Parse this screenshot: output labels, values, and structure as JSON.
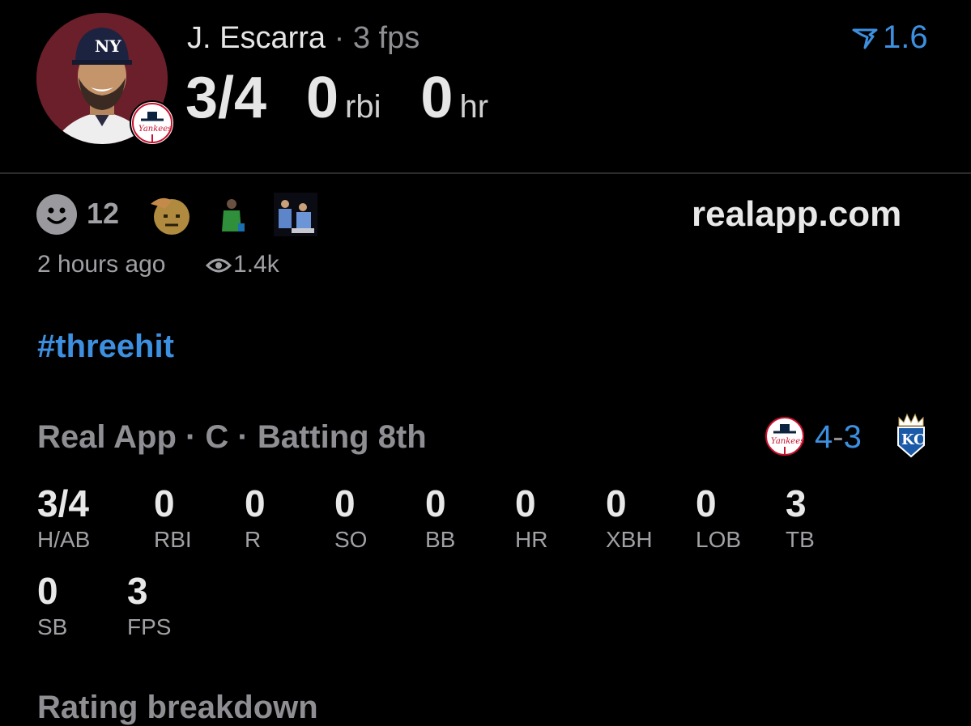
{
  "header": {
    "player_name": "J. Escarra",
    "separator": "·",
    "fps_text": "3 fps",
    "hits_ab": "3/4",
    "rbi_value": "0",
    "rbi_unit": "rbi",
    "hr_value": "0",
    "hr_unit": "hr",
    "rating": "1.6",
    "rating_icon": "real-rating-icon"
  },
  "reactions": {
    "count": "12",
    "icons": [
      "smile-icon",
      "salute-emoji-icon",
      "player-gif-icon",
      "players-gif-icon"
    ],
    "time_ago": "2 hours ago",
    "views": "1.4k",
    "domain": "realapp.com"
  },
  "hashtag": "#threehit",
  "game": {
    "info": "Real App · C · Batting 8th",
    "home_logo": "yankees-logo-icon",
    "score_left": "4",
    "score_dash": "-",
    "score_right": "3",
    "away_logo": "royals-logo-icon"
  },
  "stats_row1": [
    {
      "value": "3/4",
      "label": "H/AB"
    },
    {
      "value": "0",
      "label": "RBI"
    },
    {
      "value": "0",
      "label": "R"
    },
    {
      "value": "0",
      "label": "SO"
    },
    {
      "value": "0",
      "label": "BB"
    },
    {
      "value": "0",
      "label": "HR"
    },
    {
      "value": "0",
      "label": "XBH"
    },
    {
      "value": "0",
      "label": "LOB"
    },
    {
      "value": "3",
      "label": "TB"
    }
  ],
  "stats_row2": [
    {
      "value": "0",
      "label": "SB"
    },
    {
      "value": "3",
      "label": "FPS"
    }
  ],
  "section_title": "Rating breakdown",
  "colors": {
    "accent_blue": "#3d8fe0",
    "background": "#000000",
    "muted_text": "#8e8e93"
  }
}
